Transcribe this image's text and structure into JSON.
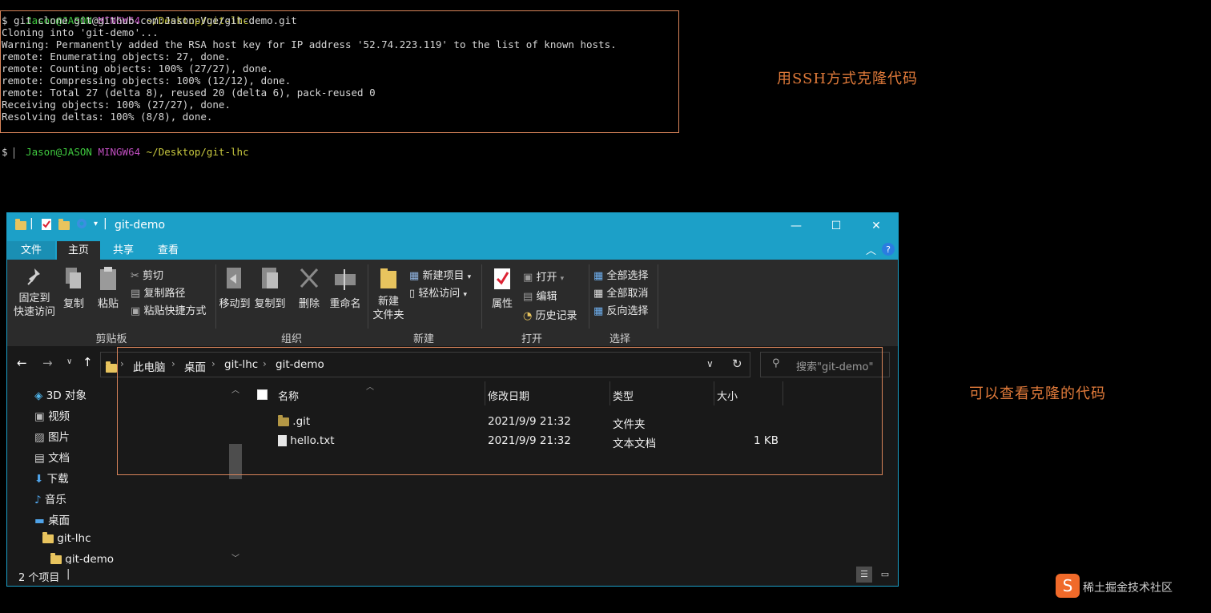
{
  "terminal": {
    "prompt1": {
      "user": "Jason@JASON",
      "shell": "MINGW64",
      "path": "~/Desktop/git-lhc"
    },
    "lines": [
      "$ git clone git@github.com:Jason-Vue/git-demo.git",
      "Cloning into 'git-demo'...",
      "Warning: Permanently added the RSA host key for IP address '52.74.223.119' to the list of known hosts.",
      "remote: Enumerating objects: 27, done.",
      "remote: Counting objects: 100% (27/27), done.",
      "remote: Compressing objects: 100% (12/12), done.",
      "remote: Total 27 (delta 8), reused 20 (delta 6), pack-reused 0",
      "Receiving objects: 100% (27/27), done.",
      "Resolving deltas: 100% (8/8), done."
    ],
    "prompt2": {
      "user": "Jason@JASON",
      "shell": "MINGW64",
      "path": "~/Desktop/git-lhc"
    },
    "last_line": "$ "
  },
  "annotations": {
    "note1": "用SSH方式克隆代码",
    "note2": "可以查看克隆的代码"
  },
  "explorer": {
    "title": "git-demo",
    "controls": {
      "minimize": "—",
      "maximize": "☐",
      "close": "✕"
    },
    "tabs": [
      "文件",
      "主页",
      "共享",
      "查看"
    ],
    "ribbon": {
      "pin": "固定到\n快速访问",
      "copy": "复制",
      "paste": "粘贴",
      "cut": "剪切",
      "copy_path": "复制路径",
      "paste_shortcut": "粘贴快捷方式",
      "group_clipboard": "剪贴板",
      "move_to": "移动到",
      "copy_to": "复制到",
      "delete": "删除",
      "rename": "重命名",
      "group_organize": "组织",
      "new_folder": "新建\n文件夹",
      "new_item": "新建项目",
      "easy_access": "轻松访问",
      "group_new": "新建",
      "properties": "属性",
      "open": "打开",
      "edit": "编辑",
      "history": "历史记录",
      "group_open": "打开",
      "select_all": "全部选择",
      "select_none": "全部取消",
      "invert_selection": "反向选择",
      "group_select": "选择"
    },
    "breadcrumb": [
      "此电脑",
      "桌面",
      "git-lhc",
      "git-demo"
    ],
    "search_placeholder": "搜索\"git-demo\"",
    "nav_items": [
      "3D 对象",
      "视频",
      "图片",
      "文档",
      "下载",
      "音乐",
      "桌面",
      "git-lhc",
      "git-demo"
    ],
    "columns": [
      "名称",
      "修改日期",
      "类型",
      "大小"
    ],
    "files": [
      {
        "name": ".git",
        "date": "2021/9/9 21:32",
        "type": "文件夹",
        "size": ""
      },
      {
        "name": "hello.txt",
        "date": "2021/9/9 21:32",
        "type": "文本文档",
        "size": "1 KB"
      }
    ],
    "status": "2 个项目"
  },
  "watermark": "稀土掘金技术社区",
  "colors": {
    "accent": "#1ca0c8",
    "highlight": "#d9845a",
    "note": "#e07a3a"
  }
}
